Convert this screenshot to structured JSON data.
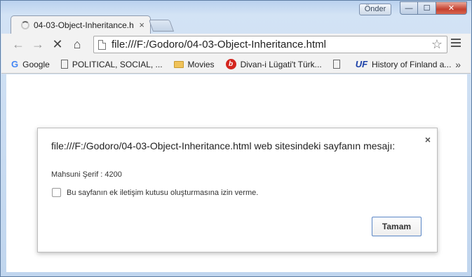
{
  "titlebar": {
    "user_button": "Önder",
    "minimize": "—",
    "maximize": "☐",
    "close": "✕"
  },
  "tab": {
    "title": "04-03-Object-Inheritance.h",
    "close": "×"
  },
  "toolbar": {
    "back": "←",
    "forward": "→",
    "stop": "✕",
    "home": "⌂",
    "url": "file:///F:/Godoro/04-03-Object-Inheritance.html",
    "star": "☆"
  },
  "bookmarks": {
    "items": [
      {
        "label": "Google",
        "icon": "google-icon"
      },
      {
        "label": "POLITICAL, SOCIAL, ...",
        "icon": "page-icon"
      },
      {
        "label": "Movies",
        "icon": "folder-icon"
      },
      {
        "label": "Divan-i Lügati't Türk...",
        "icon": "divan-icon"
      },
      {
        "label": "",
        "icon": "page-icon"
      },
      {
        "label": "History of Finland a...",
        "icon": "uf-icon"
      }
    ],
    "more": "»"
  },
  "dialog": {
    "title": "file:///F:/Godoro/04-03-Object-Inheritance.html web sitesindeki sayfanın mesajı:",
    "close": "×",
    "message": "Mahsuni Şerif : 4200",
    "checkbox_label": "Bu sayfanın ek iletişim kutusu oluşturmasına izin verme.",
    "ok_label": "Tamam"
  }
}
